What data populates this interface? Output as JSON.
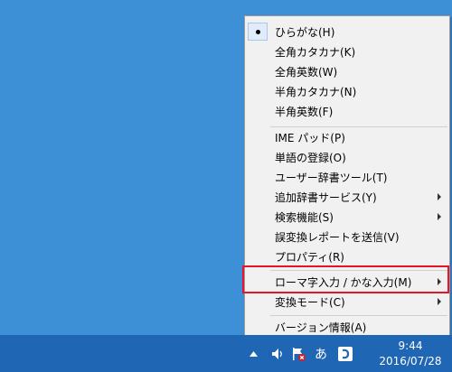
{
  "menu": {
    "items": [
      {
        "label": "ひらがな(H)",
        "checked": true
      },
      {
        "label": "全角カタカナ(K)"
      },
      {
        "label": "全角英数(W)"
      },
      {
        "label": "半角カタカナ(N)"
      },
      {
        "label": "半角英数(F)"
      },
      {
        "label": "IME パッド(P)"
      },
      {
        "label": "単語の登録(O)"
      },
      {
        "label": "ユーザー辞書ツール(T)"
      },
      {
        "label": "追加辞書サービス(Y)",
        "submenu": true
      },
      {
        "label": "検索機能(S)",
        "submenu": true
      },
      {
        "label": "誤変換レポートを送信(V)"
      },
      {
        "label": "プロパティ(R)"
      },
      {
        "label": "ローマ字入力 / かな入力(M)",
        "submenu": true,
        "highlighted": true
      },
      {
        "label": "変換モード(C)",
        "submenu": true
      },
      {
        "label": "バージョン情報(A)"
      }
    ]
  },
  "taskbar": {
    "ime_indicator": "あ",
    "clock_time": "9:44",
    "clock_date": "2016/07/28"
  },
  "colors": {
    "desktop": "#3d8fd6",
    "taskbar": "#1f66b4",
    "highlight_border": "#e8132a"
  }
}
